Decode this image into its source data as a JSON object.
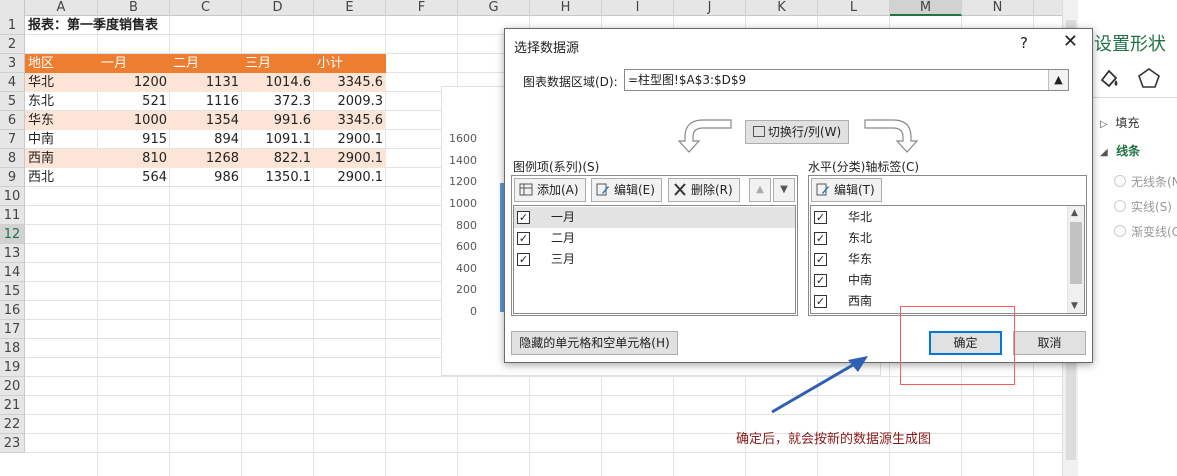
{
  "sheet": {
    "columns": [
      "A",
      "B",
      "C",
      "D",
      "E",
      "F",
      "G",
      "H",
      "I",
      "J",
      "K",
      "L",
      "M",
      "N"
    ],
    "selected_column": "M",
    "rows": [
      "1",
      "2",
      "3",
      "4",
      "5",
      "6",
      "7",
      "8",
      "9",
      "10",
      "11",
      "12",
      "13",
      "14",
      "15",
      "16",
      "17",
      "18",
      "19",
      "20",
      "21",
      "22",
      "23"
    ],
    "selected_row": "12",
    "title": "报表：第一季度销售表",
    "header": [
      "地区",
      "一月",
      "二月",
      "三月",
      "小计"
    ],
    "data": [
      [
        "华北",
        "1200",
        "1131",
        "1014.6",
        "3345.6"
      ],
      [
        "东北",
        "521",
        "1116",
        "372.3",
        "2009.3"
      ],
      [
        "华东",
        "1000",
        "1354",
        "991.6",
        "3345.6"
      ],
      [
        "中南",
        "915",
        "894",
        "1091.1",
        "2900.1"
      ],
      [
        "西南",
        "810",
        "1268",
        "822.1",
        "2900.1"
      ],
      [
        "西北",
        "564",
        "986",
        "1350.1",
        "2900.1"
      ]
    ],
    "header_color": "#ed7d31",
    "band_color": "#fce4d6"
  },
  "chart_data": {
    "type": "bar",
    "yticks": [
      "1600",
      "1400",
      "1200",
      "1000",
      "800",
      "600",
      "400",
      "200",
      "0"
    ],
    "ylim": [
      0,
      1600
    ],
    "series_color": "#5b9bd5"
  },
  "dialog": {
    "title": "选择数据源",
    "help": "?",
    "close": "✕",
    "range_label": "图表数据区域(D):",
    "range_value": "=柱型图!$A$3:$D$9",
    "switch_label": "切换行/列(W)",
    "legend_label": "图例项(系列)(S)",
    "add_label": "添加(A)",
    "edit_label": "编辑(E)",
    "delete_label": "删除(R)",
    "series": [
      "一月",
      "二月",
      "三月"
    ],
    "axis_label": "水平(分类)轴标签(C)",
    "axis_edit_label": "编辑(T)",
    "categories": [
      "华北",
      "东北",
      "华东",
      "中南",
      "西南"
    ],
    "hidden_cells_label": "隐藏的单元格和空单元格(H)",
    "ok_label": "确定",
    "cancel_label": "取消"
  },
  "pane": {
    "title": "设置形状",
    "fill_label": "填充",
    "line_label": "线条",
    "opt_none": "无线条(N)",
    "opt_solid": "实线(S)",
    "opt_gradient": "渐变线(G)"
  },
  "annotation": "确定后，就会按新的数据源生成图"
}
